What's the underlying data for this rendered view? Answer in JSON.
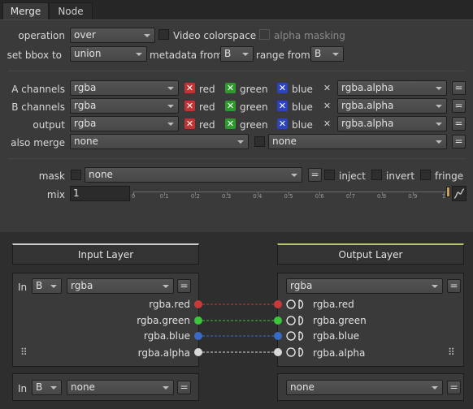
{
  "tabs": [
    {
      "label": "Merge"
    },
    {
      "label": "Node"
    }
  ],
  "operation": {
    "label": "operation",
    "value": "over",
    "video_colorspace_label": "Video colorspace",
    "alpha_masking_label": "alpha masking"
  },
  "bbox": {
    "label": "set bbox to",
    "value": "union",
    "metadata_from_label": "metadata from",
    "metadata_from_value": "B",
    "range_from_label": "range from",
    "range_from_value": "B"
  },
  "channels": [
    {
      "label": "A channels",
      "layer": "rgba",
      "red": "red",
      "green": "green",
      "blue": "blue",
      "alpha": "rgba.alpha"
    },
    {
      "label": "B channels",
      "layer": "rgba",
      "red": "red",
      "green": "green",
      "blue": "blue",
      "alpha": "rgba.alpha"
    },
    {
      "label": "output",
      "layer": "rgba",
      "red": "red",
      "green": "green",
      "blue": "blue",
      "alpha": "rgba.alpha"
    }
  ],
  "also_merge": {
    "label": "also merge",
    "value1": "none",
    "value2": "none"
  },
  "eq_label": "=",
  "mask": {
    "label": "mask",
    "value": "none",
    "inject_label": "inject",
    "invert_label": "invert",
    "fringe_label": "fringe"
  },
  "mix": {
    "label": "mix",
    "value": "1",
    "ticks": [
      "0",
      "0.1",
      "0.2",
      "0.3",
      "0.4",
      "0.5",
      "0.6",
      "0.7",
      "0.8",
      "0.9",
      "1"
    ]
  },
  "shuffle": {
    "input_header": "Input Layer",
    "output_header": "Output Layer",
    "in_label": "In",
    "input1": {
      "source": "B",
      "layer": "rgba"
    },
    "output1": {
      "layer": "rgba"
    },
    "in_channels": [
      "rgba.red",
      "rgba.green",
      "rgba.blue",
      "rgba.alpha"
    ],
    "out_channels": [
      "rgba.red",
      "rgba.green",
      "rgba.blue",
      "rgba.alpha"
    ],
    "channel_colors": [
      "#c83a3a",
      "#3cc43c",
      "#3a6ac8",
      "#d8d8d8"
    ],
    "input2": {
      "source": "B",
      "layer": "none"
    },
    "output2": {
      "layer": "none"
    }
  },
  "colors": {
    "accent_output": "#b8c86a",
    "header_underline_input": "#cfcfcf"
  }
}
